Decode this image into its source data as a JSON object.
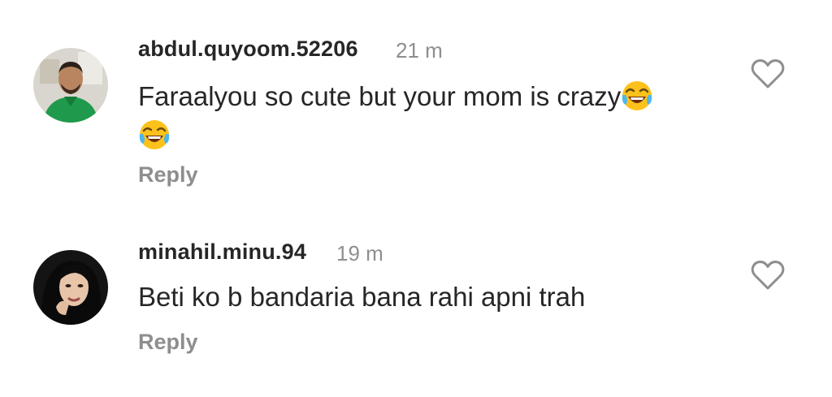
{
  "comments": [
    {
      "username": "abdul.quyoom.52206",
      "time": "21 m",
      "text": "Faraalyou so cute but your mom is crazy",
      "emojis": [
        "face-with-tears-of-joy",
        "face-with-tears-of-joy"
      ],
      "reply_label": "Reply",
      "like_icon": "heart-outline-icon"
    },
    {
      "username": "minahil.minu.94",
      "time": "19 m",
      "text": "Beti ko b bandaria bana rahi apni trah",
      "reply_label": "Reply",
      "like_icon": "heart-outline-icon"
    }
  ],
  "colors": {
    "username": "#262626",
    "secondary_text": "#8e8e8e",
    "icon_stroke": "#8e8e8e",
    "background": "#ffffff"
  }
}
